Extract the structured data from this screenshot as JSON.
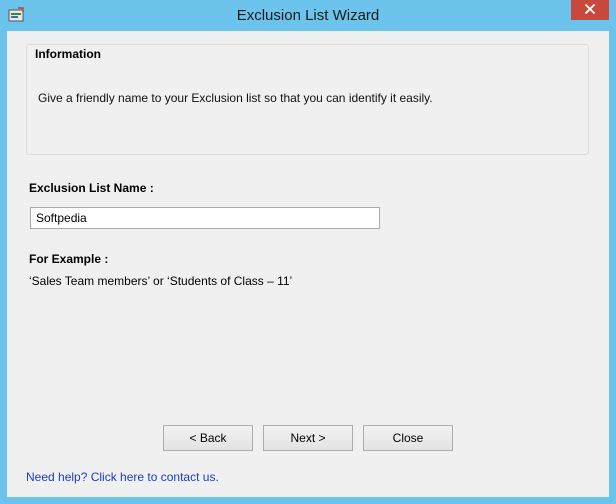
{
  "window": {
    "title": "Exclusion List Wizard",
    "app_icon": "wizard-app-icon",
    "close_icon": "close-icon",
    "accent_color": "#6cc3ec",
    "close_color": "#c7493b"
  },
  "info": {
    "heading": "Information",
    "text": "Give a friendly name to your Exclusion list so that you can identify it easily."
  },
  "form": {
    "name_label": "Exclusion List Name :",
    "name_value": "Softpedia"
  },
  "example": {
    "heading": "For Example :",
    "text": "‘Sales Team members’ or ‘Students of Class – 11’"
  },
  "buttons": {
    "back": "< Back",
    "next": "Next >",
    "close": "Close"
  },
  "help": {
    "link_text": "Need help? Click here to contact us.",
    "link_color": "#1a3cc8"
  }
}
